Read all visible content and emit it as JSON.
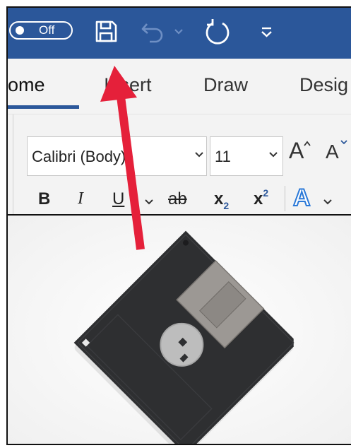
{
  "qat": {
    "autosave_toggle_label": "Off",
    "icons": [
      "save-icon",
      "undo-icon",
      "redo-icon",
      "customize-qat-icon"
    ]
  },
  "tabs": [
    {
      "label": "ome",
      "active": true
    },
    {
      "label": "Insert",
      "active": false
    },
    {
      "label": "Draw",
      "active": false
    },
    {
      "label": "Desig",
      "active": false
    }
  ],
  "font": {
    "family": "Calibri (Body)",
    "size": "11",
    "grow_label": "A",
    "shrink_label": "A"
  },
  "format": {
    "bold": "B",
    "italic": "I",
    "underline": "U",
    "strike": "ab",
    "subscript": "x",
    "subscript_mark": "2",
    "superscript": "x",
    "superscript_mark": "2",
    "text_effects": "A"
  },
  "colors": {
    "title_bar": "#2b579a",
    "ribbon_bg": "#f3f3f3",
    "arrow": "#e5203a",
    "disk": "#2e2f31",
    "shutter": "#9c9894"
  }
}
